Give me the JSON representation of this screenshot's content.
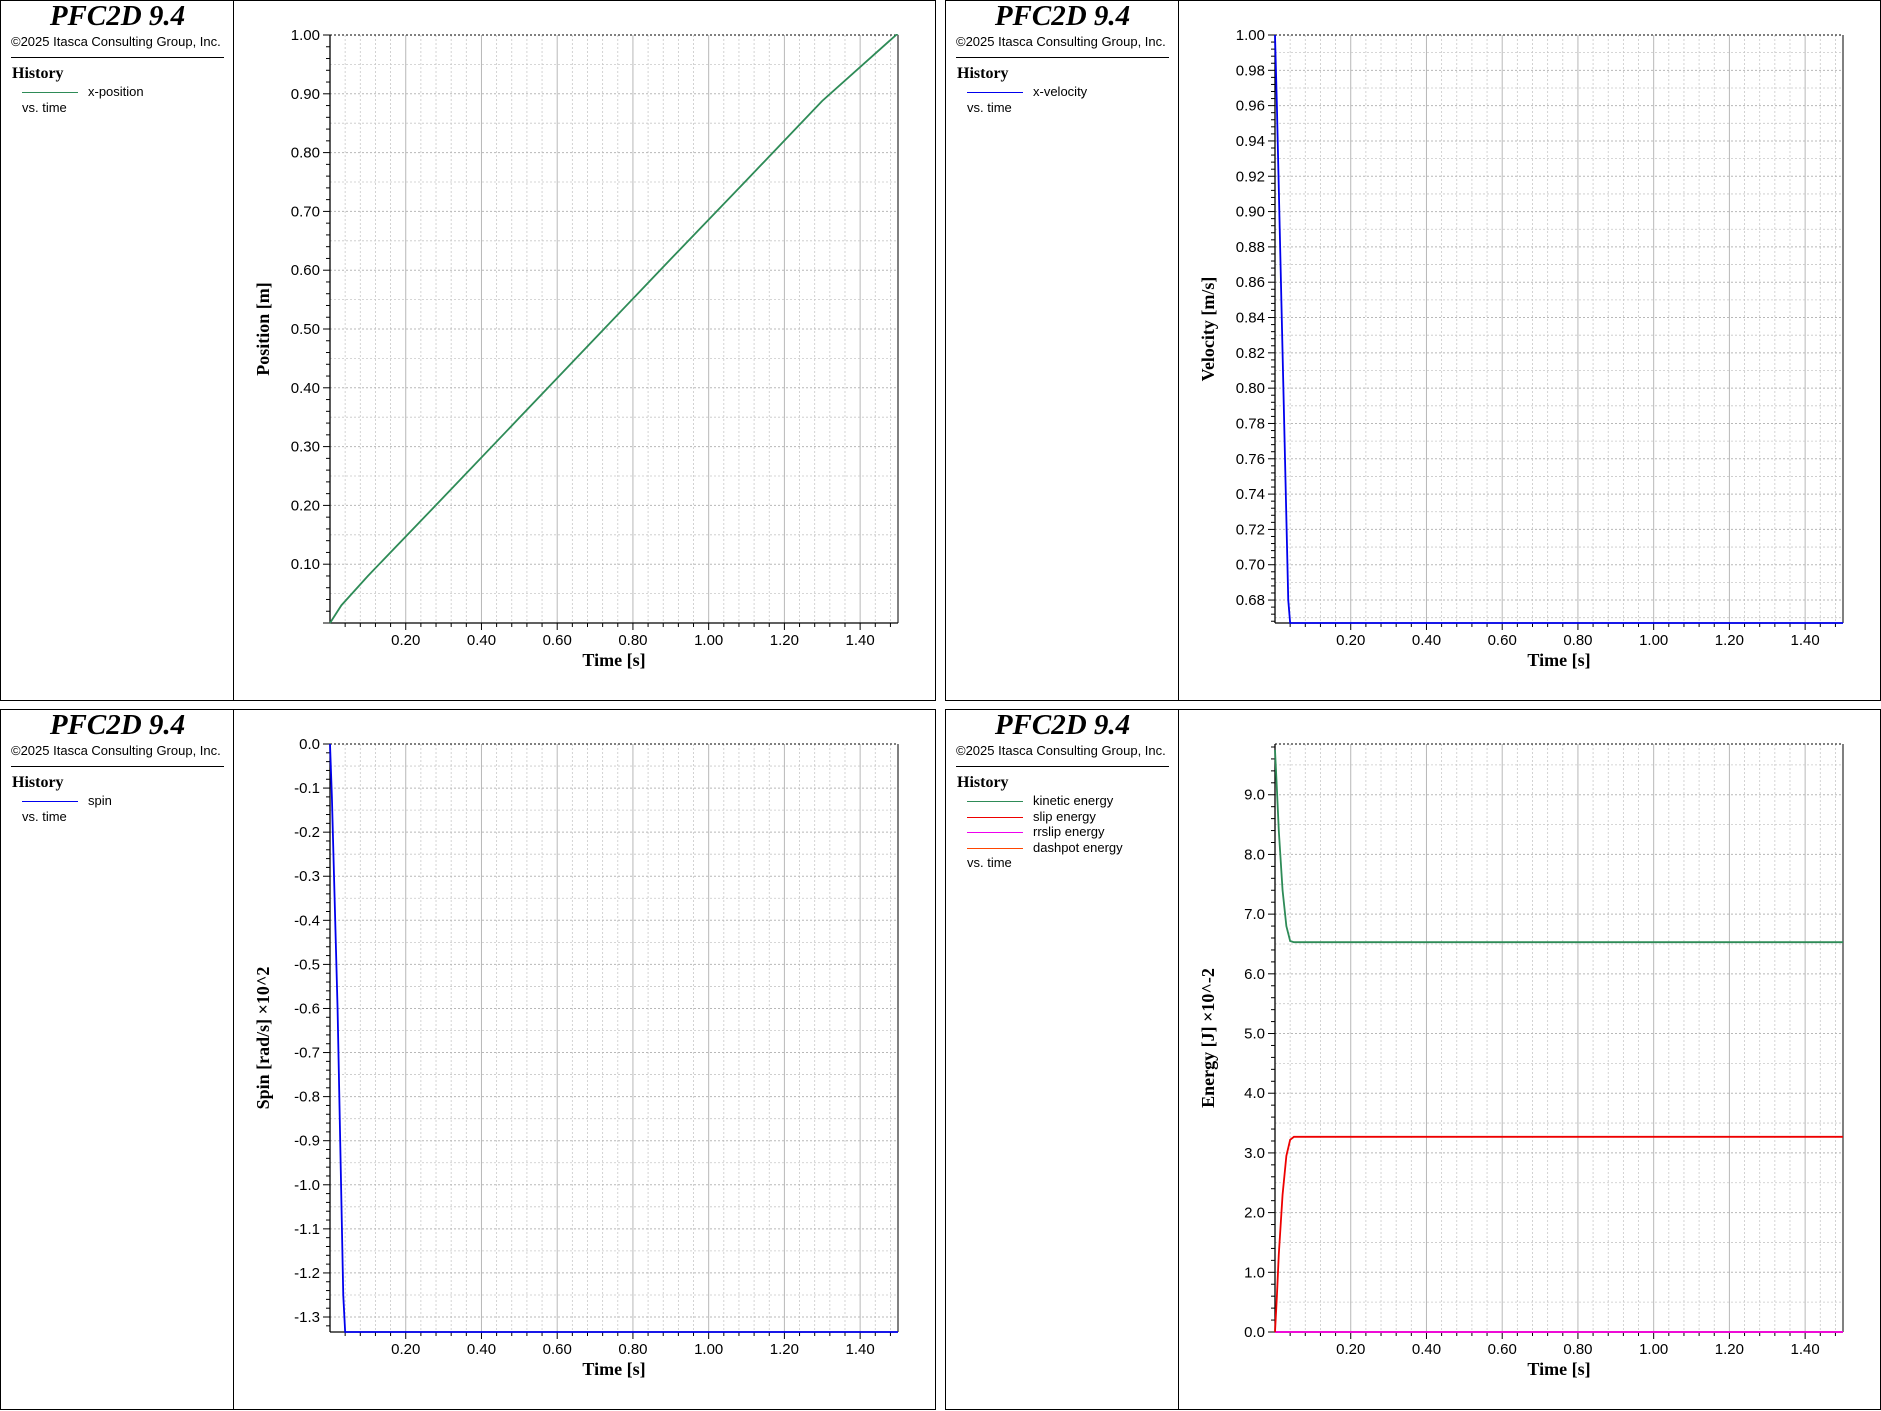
{
  "app": {
    "title": "PFC2D 9.4",
    "copyright": "©2025 Itasca Consulting Group, Inc.",
    "history_label": "History",
    "vs_time": "vs. time"
  },
  "chart_data": [
    {
      "type": "line",
      "xlabel": "Time [s]",
      "ylabel": "Position [m]",
      "xlim": [
        0,
        1.5
      ],
      "ylim": [
        0,
        1.0
      ],
      "xticks": [
        "0.20",
        "0.40",
        "0.60",
        "0.80",
        "1.00",
        "1.20",
        "1.40"
      ],
      "yticks": [
        "0.10",
        "0.20",
        "0.30",
        "0.40",
        "0.50",
        "0.60",
        "0.70",
        "0.80",
        "0.90",
        "1.00"
      ],
      "grid": true,
      "legend": "left-pane",
      "series": [
        {
          "name": "x-position",
          "color": "#2e8b57",
          "x": [
            0,
            0.03,
            0.1,
            0.3,
            0.5,
            0.7,
            0.9,
            1.1,
            1.3,
            1.5
          ],
          "y": [
            0,
            0.03,
            0.08,
            0.214,
            0.349,
            0.484,
            0.619,
            0.753,
            0.888,
            1.003
          ]
        }
      ]
    },
    {
      "type": "line",
      "xlabel": "Time [s]",
      "ylabel": "Velocity [m/s]",
      "xlim": [
        0,
        1.5
      ],
      "ylim": [
        0.667,
        1.0
      ],
      "xticks": [
        "0.20",
        "0.40",
        "0.60",
        "0.80",
        "1.00",
        "1.20",
        "1.40"
      ],
      "yticks": [
        "0.68",
        "0.70",
        "0.72",
        "0.74",
        "0.76",
        "0.78",
        "0.80",
        "0.82",
        "0.84",
        "0.86",
        "0.88",
        "0.90",
        "0.92",
        "0.94",
        "0.96",
        "0.98",
        "1.00"
      ],
      "grid": true,
      "legend": "left-pane",
      "series": [
        {
          "name": "x-velocity",
          "color": "#0000ee",
          "x": [
            0,
            0.005,
            0.02,
            0.035,
            0.04,
            0.2,
            0.6,
            1.0,
            1.5
          ],
          "y": [
            1.0,
            0.96,
            0.82,
            0.68,
            0.667,
            0.667,
            0.667,
            0.667,
            0.667
          ]
        }
      ]
    },
    {
      "type": "line",
      "xlabel": "Time [s]",
      "ylabel": "Spin [rad/s] ×10^2",
      "xlim": [
        0,
        1.5
      ],
      "ylim": [
        -1.334,
        0.0
      ],
      "xticks": [
        "0.20",
        "0.40",
        "0.60",
        "0.80",
        "1.00",
        "1.20",
        "1.40"
      ],
      "yticks": [
        "0.0",
        "-0.1",
        "-0.2",
        "-0.3",
        "-0.4",
        "-0.5",
        "-0.6",
        "-0.7",
        "-0.8",
        "-0.9",
        "-1.0",
        "-1.1",
        "-1.2",
        "-1.3"
      ],
      "grid": true,
      "legend": "left-pane",
      "series": [
        {
          "name": "spin",
          "color": "#0000ee",
          "x": [
            0,
            0.005,
            0.02,
            0.035,
            0.04,
            0.2,
            0.6,
            1.0,
            1.5
          ],
          "y": [
            0,
            -0.12,
            -0.6,
            -1.25,
            -1.334,
            -1.334,
            -1.334,
            -1.334,
            -1.334
          ]
        }
      ]
    },
    {
      "type": "line",
      "xlabel": "Time [s]",
      "ylabel": "Energy [J] ×10^-2",
      "xlim": [
        0,
        1.5
      ],
      "ylim": [
        0,
        9.85
      ],
      "xticks": [
        "0.20",
        "0.40",
        "0.60",
        "0.80",
        "1.00",
        "1.20",
        "1.40"
      ],
      "yticks": [
        "0.0",
        "1.0",
        "2.0",
        "3.0",
        "4.0",
        "5.0",
        "6.0",
        "7.0",
        "8.0",
        "9.0"
      ],
      "grid": true,
      "legend": "left-pane",
      "series": [
        {
          "name": "kinetic energy",
          "color": "#2e8b57",
          "x": [
            0,
            0.005,
            0.01,
            0.02,
            0.03,
            0.04,
            0.05,
            0.2,
            0.6,
            1.0,
            1.5
          ],
          "y": [
            9.75,
            9.1,
            8.4,
            7.4,
            6.8,
            6.55,
            6.53,
            6.53,
            6.53,
            6.53,
            6.53
          ]
        },
        {
          "name": "slip energy",
          "color": "#ee0000",
          "x": [
            0,
            0.005,
            0.01,
            0.02,
            0.03,
            0.04,
            0.05,
            0.2,
            0.6,
            1.0,
            1.5
          ],
          "y": [
            0,
            0.6,
            1.3,
            2.3,
            2.95,
            3.22,
            3.27,
            3.27,
            3.27,
            3.27,
            3.27
          ]
        },
        {
          "name": "rrslip energy",
          "color": "#ee00ee",
          "x": [
            0,
            1.5
          ],
          "y": [
            0,
            0
          ]
        },
        {
          "name": "dashpot energy",
          "color": "#ff4500",
          "x": [
            0,
            1.5
          ],
          "y": [
            0,
            0
          ]
        }
      ]
    }
  ]
}
